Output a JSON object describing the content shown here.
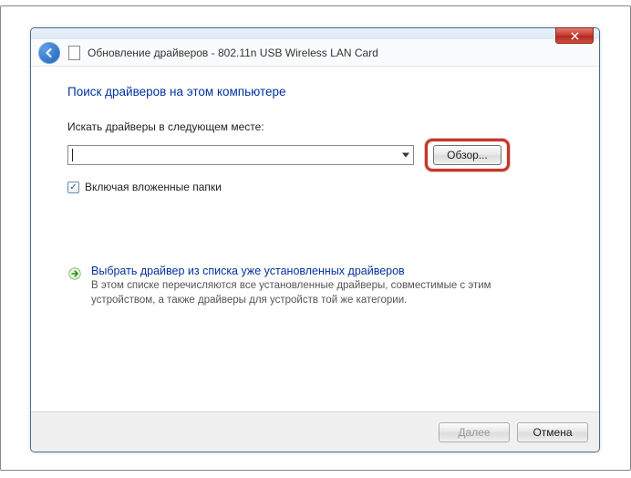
{
  "window": {
    "title": "Обновление драйверов - 802.11n USB Wireless LAN Card"
  },
  "content": {
    "heading": "Поиск драйверов на этом компьютере",
    "path_label": "Искать драйверы в следующем месте:",
    "path_value": "",
    "browse_label": "Обзор...",
    "include_subfolders_label": "Включая вложенные папки",
    "include_subfolders_checked": true
  },
  "option": {
    "title": "Выбрать драйвер из списка уже установленных драйверов",
    "desc": "В этом списке перечисляются все установленные драйверы, совместимые с этим устройством, а также драйверы для устройств той же категории."
  },
  "footer": {
    "next_label": "Далее",
    "cancel_label": "Отмена"
  },
  "icons": {
    "back": "back-arrow",
    "close": "close-x",
    "doc": "document",
    "arrow": "green-arrow-right",
    "check": "✓",
    "dropdown": "chevron-down"
  }
}
